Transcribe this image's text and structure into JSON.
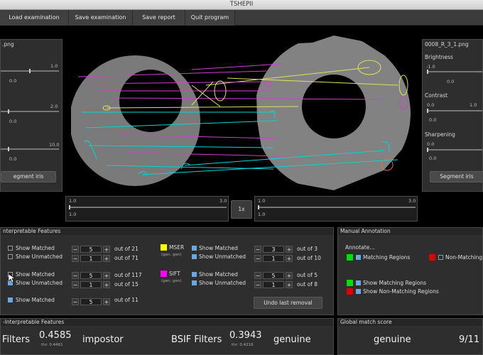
{
  "window": {
    "title": "TSHEPII"
  },
  "menu": [
    "Load examination",
    "Save examination",
    "Save report",
    "Quit program"
  ],
  "left_panel": {
    "filename": ".png",
    "slider_max": [
      "1.0",
      "2.0",
      "10.0"
    ],
    "slider_val": [
      "0.0",
      "0.0",
      "0.0"
    ],
    "button": "egment iris"
  },
  "right_panel": {
    "filename": "0008_R_3_1.png",
    "brightness_label": "Brightness",
    "brightness_val": "-1.0",
    "brightness_mid": "0.0",
    "contrast_label": "Contrast",
    "contrast_min": "0.0",
    "contrast_max": "1.0",
    "contrast_mid": "0.0",
    "sharpening_label": "Sharpening",
    "sharpening_min": "0.0",
    "sharpening_mid": "0.0",
    "button": "Segment iris"
  },
  "zoom": {
    "left": {
      "min": "1.0",
      "max": "3.0",
      "val": "1.0"
    },
    "label": "1x",
    "right": {
      "min": "1.0",
      "max": "3.0",
      "val": "1.0"
    }
  },
  "features": {
    "title": "nterpretable Features",
    "show_matched": "Show Matched",
    "show_unmatched": "Show Unmatched",
    "out_of": "out of",
    "row1": {
      "v1": "5",
      "t1": "21",
      "v2": "1",
      "t2": "71"
    },
    "row2": {
      "v1": "5",
      "t1": "117",
      "v2": "1",
      "t2": "15"
    },
    "row3": {
      "v1": "5",
      "t1": "11"
    },
    "mser": {
      "name": "MSER",
      "sub": "(gen, gen)",
      "v1": "3",
      "t1": "3",
      "v2": "1",
      "t2": "10"
    },
    "sift": {
      "name": "SIFT",
      "sub": "(gen, gen)",
      "v1": "5",
      "t1": "5",
      "v2": "1",
      "t2": "8"
    },
    "undo": "Undo last removal",
    "mser_color": "#ffff00",
    "sift_color": "#ff00ff"
  },
  "annotation": {
    "title": "Manual Annotation",
    "annotate": "Annotate...",
    "matching": "Matching Regions",
    "non_matching": "Non-Matching",
    "show_matching": "Show Matching Regions",
    "show_non_matching": "Show Non-Matching Regions",
    "green": "#00e000",
    "red": "#e00000"
  },
  "noninterp": {
    "title": "-Interpretable Features",
    "filters_label": "Filters",
    "score1": "0.4585",
    "thr1": "thr: 0.4461",
    "verdict1": "impostor",
    "bsif_label": "BSIF Filters",
    "score2": "0.3943",
    "thr2": "thr: 0.4216",
    "verdict2": "genuine"
  },
  "global": {
    "title": "Global match score",
    "verdict": "genuine",
    "score": "9/11"
  }
}
